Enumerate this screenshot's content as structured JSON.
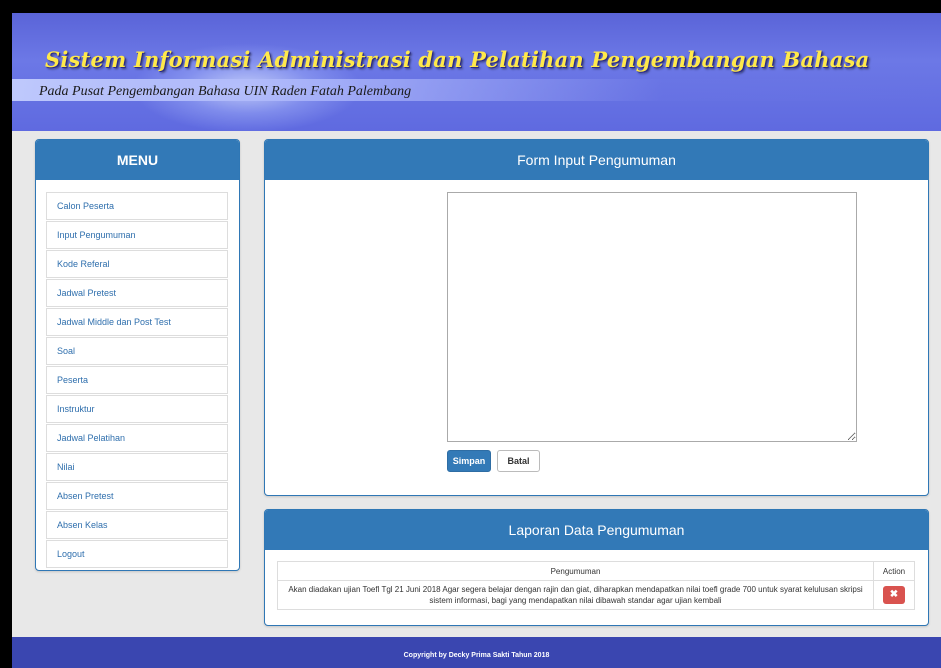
{
  "header": {
    "title": "Sistem Informasi Administrasi dan Pelatihan Pengembangan Bahasa",
    "subtitle": "Pada Pusat Pengembangan Bahasa UIN Raden Fatah Palembang"
  },
  "menu": {
    "heading": "MENU",
    "items": [
      {
        "label": "Calon Peserta"
      },
      {
        "label": "Input Pengumuman"
      },
      {
        "label": "Kode Referal"
      },
      {
        "label": "Jadwal Pretest"
      },
      {
        "label": "Jadwal Middle dan Post Test"
      },
      {
        "label": "Soal"
      },
      {
        "label": "Peserta"
      },
      {
        "label": "Instruktur"
      },
      {
        "label": "Jadwal Pelatihan"
      },
      {
        "label": "Nilai"
      },
      {
        "label": "Absen Pretest"
      },
      {
        "label": "Absen Kelas"
      },
      {
        "label": "Logout"
      }
    ]
  },
  "form": {
    "heading": "Form Input Pengumuman",
    "textarea_value": "",
    "save_label": "Simpan",
    "cancel_label": "Batal"
  },
  "report": {
    "heading": "Laporan Data Pengumuman",
    "columns": [
      "Pengumuman",
      "Action"
    ],
    "rows": [
      {
        "text": "Akan diadakan ujian Toefl Tgl 21 Juni 2018 Agar segera belajar dengan rajin dan giat, diharapkan mendapatkan nilai toefl grade 700 untuk syarat kelulusan skripsi sistem informasi, bagi yang mendapatkan nilai dibawah standar agar ujian kembali",
        "action_icon": "close-icon"
      }
    ]
  },
  "footer": {
    "copyright": "Copyright by Decky Prima Sakti Tahun 2018"
  },
  "colors": {
    "header_bg": "#5f6ae0",
    "title_color": "#ffe94a",
    "panel_head": "#3279b7",
    "danger": "#d9534f",
    "footer_bg": "#3a46b0"
  }
}
